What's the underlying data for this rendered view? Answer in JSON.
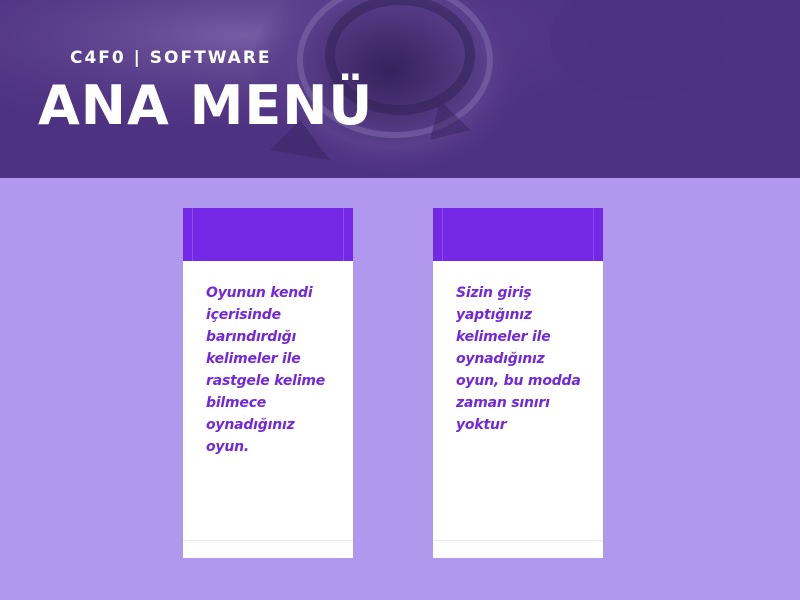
{
  "header": {
    "brand": "C4F0 | SOFTWARE",
    "title": "ANA MENÜ"
  },
  "cards": [
    {
      "description": "Oyunun kendi içerisinde barındırdığı kelimeler ile rastgele kelime bilmece oynadığınız oyun."
    },
    {
      "description": "Sizin giriş yaptığınız kelimeler ile oynadığınız oyun, bu modda zaman sınırı yoktur"
    }
  ],
  "colors": {
    "header_bg": "#4e3282",
    "page_bg": "#b098ee",
    "card_accent": "#7428e6",
    "card_text": "#7128de"
  }
}
